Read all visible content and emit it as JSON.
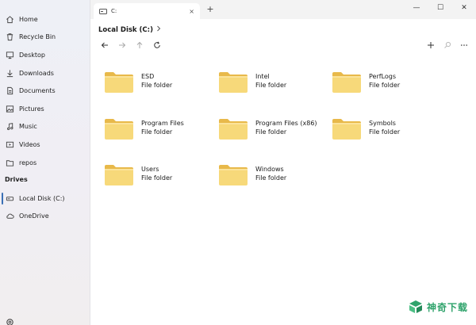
{
  "window": {
    "tab_title": "C:",
    "tab_close": "×",
    "new_tab": "+",
    "minimize": "—",
    "maximize": "☐",
    "close": "✕"
  },
  "sidebar": {
    "items": [
      {
        "label": "Home",
        "icon": "home-icon"
      },
      {
        "label": "Recycle Bin",
        "icon": "recycle-bin-icon"
      },
      {
        "label": "Desktop",
        "icon": "desktop-icon"
      },
      {
        "label": "Downloads",
        "icon": "download-icon"
      },
      {
        "label": "Documents",
        "icon": "document-icon"
      },
      {
        "label": "Pictures",
        "icon": "picture-icon"
      },
      {
        "label": "Music",
        "icon": "music-icon"
      },
      {
        "label": "Videos",
        "icon": "video-icon"
      },
      {
        "label": "repos",
        "icon": "folder-outline-icon"
      }
    ],
    "drives_label": "Drives",
    "drives": [
      {
        "label": "Local Disk (C:)",
        "icon": "drive-icon",
        "selected": true
      },
      {
        "label": "OneDrive",
        "icon": "cloud-icon",
        "selected": false
      }
    ],
    "settings_icon": "settings-icon"
  },
  "main": {
    "breadcrumb": "Local Disk (C:)",
    "breadcrumb_chevron": ">",
    "toolbar": {
      "back": "back-arrow-icon",
      "forward": "forward-arrow-icon",
      "up": "up-arrow-icon",
      "refresh": "refresh-icon",
      "new": "plus-icon",
      "search": "search-icon",
      "more": "more-icon"
    },
    "items": [
      {
        "name": "ESD",
        "type": "File folder"
      },
      {
        "name": "Intel",
        "type": "File folder"
      },
      {
        "name": "PerfLogs",
        "type": "File folder"
      },
      {
        "name": "Program Files",
        "type": "File folder"
      },
      {
        "name": "Program Files (x86)",
        "type": "File folder"
      },
      {
        "name": "Symbols",
        "type": "File folder"
      },
      {
        "name": "Users",
        "type": "File folder"
      },
      {
        "name": "Windows",
        "type": "File folder"
      }
    ]
  },
  "watermark": {
    "text": "神奇下载"
  },
  "colors": {
    "accent": "#3a6fb5",
    "folder": "#f7d97a",
    "folder_back": "#e8b94a",
    "watermark": "#2fa36b"
  }
}
